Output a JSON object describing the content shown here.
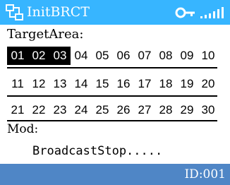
{
  "title": "InitBRCT",
  "icons": {
    "app": "network-icon",
    "key": "key-icon",
    "signal": "signal-strength-icon"
  },
  "colors": {
    "title_bar": "#37b5ff",
    "bottom_bar": "#4f86c6",
    "selected_bg": "#000000",
    "selected_fg": "#ffffff"
  },
  "target_area": {
    "label": "TargetArea:",
    "rows": [
      [
        "01",
        "02",
        "03",
        "04",
        "05",
        "06",
        "07",
        "08",
        "09",
        "10"
      ],
      [
        "11",
        "12",
        "13",
        "14",
        "15",
        "16",
        "17",
        "18",
        "19",
        "20"
      ],
      [
        "21",
        "22",
        "23",
        "24",
        "25",
        "26",
        "27",
        "28",
        "29",
        "30"
      ]
    ],
    "selected": [
      "01",
      "02",
      "03"
    ]
  },
  "mod": {
    "label": "Mod:",
    "value": ""
  },
  "status": "BroadcastStop.....",
  "footer": {
    "id_text": "ID:001"
  }
}
